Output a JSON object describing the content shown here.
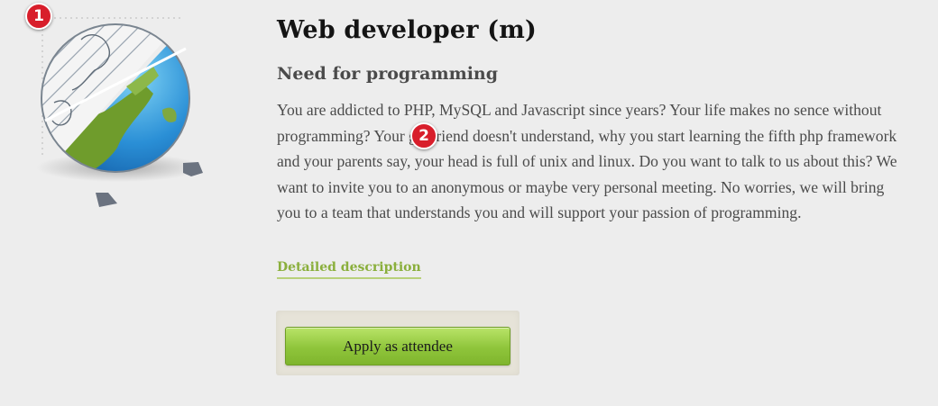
{
  "job": {
    "title": "Web developer (m)",
    "subtitle": "Need for programming",
    "description": "You are addicted to PHP, MySQL and Javascript since years? Your life makes no sence without programming? Your girlfriend doesn't understand, why you start learning the fifth php framework and your parents say, your head is full of unix and linux. Do you want to talk to us about this? We want to invite you to an anonymous or maybe very personal meeting. No worries, we will bring you to a team that understands you and will support your passion of programming.",
    "details_link": "Detailed description",
    "apply_label": "Apply as attendee"
  },
  "badges": {
    "first": "1",
    "second": "2"
  },
  "colors": {
    "background": "#ededed",
    "link_green": "#8aaf3c",
    "button_green": "#8fc53b",
    "badge_red": "#d81e2b"
  },
  "illustration": {
    "icon": "globe-half-sketch-icon"
  }
}
